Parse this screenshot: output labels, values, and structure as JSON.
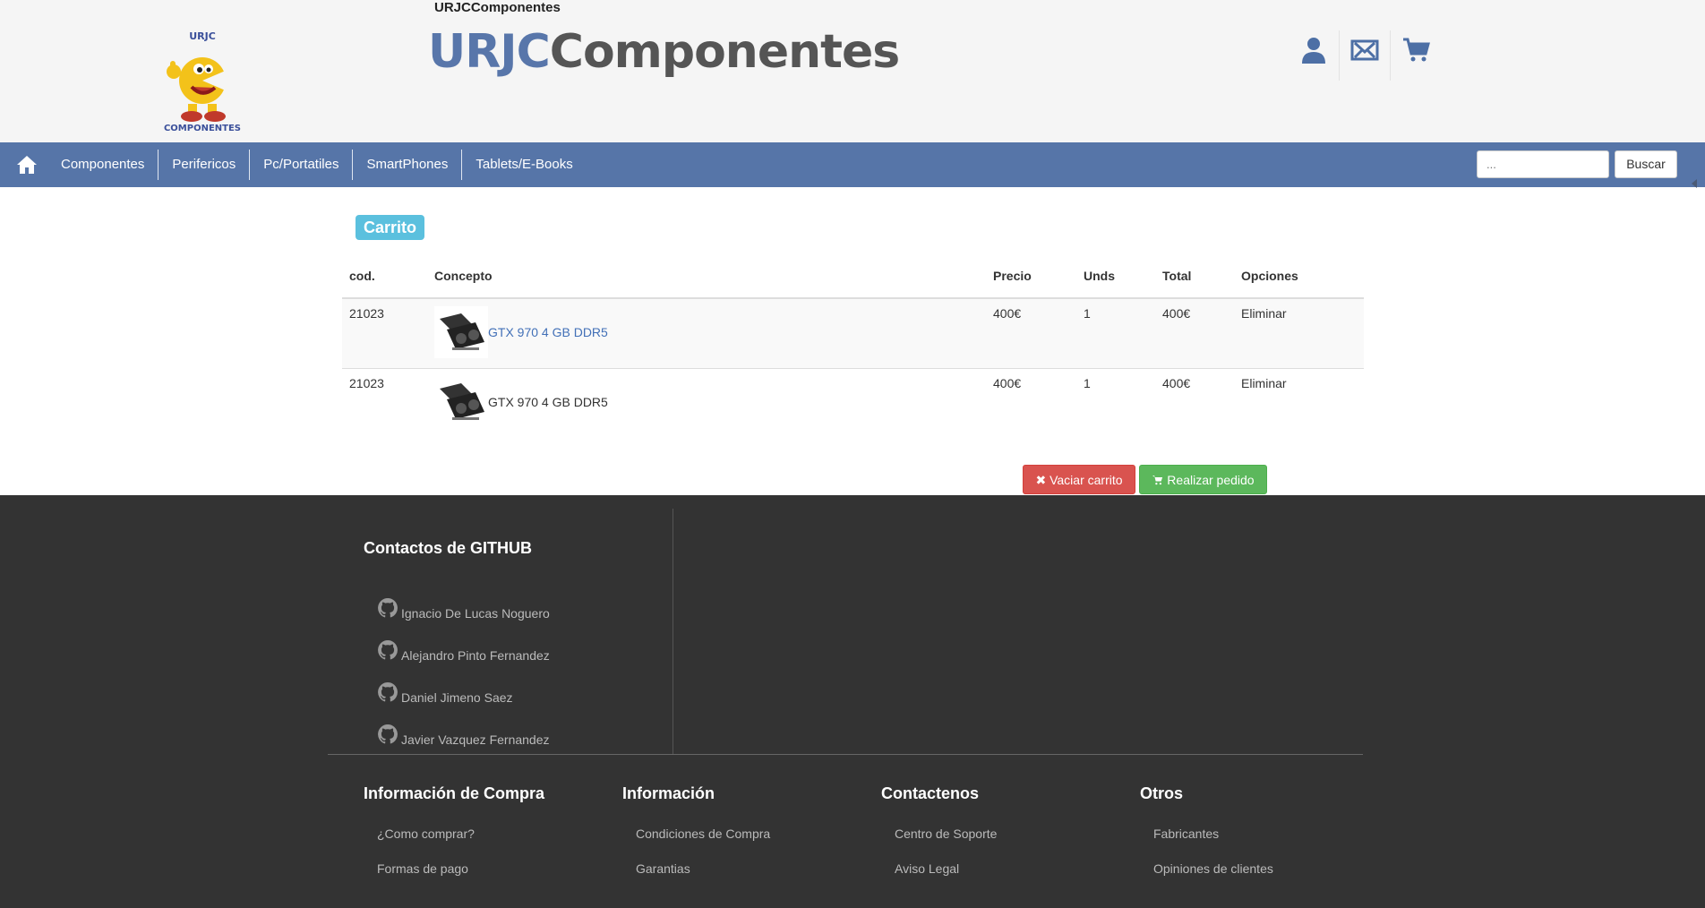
{
  "header": {
    "top_name": "URJCComponentes",
    "brand_part1": "URJC",
    "brand_part2": "Componentes",
    "logo_text": "URJC COMPONENTES",
    "icons": [
      "user-icon",
      "envelope-icon",
      "cart-icon"
    ]
  },
  "nav": {
    "home_icon": "home-icon",
    "items": [
      "Componentes",
      "Perifericos",
      "Pc/Portatiles",
      "SmartPhones",
      "Tablets/E-Books"
    ],
    "search_placeholder": "...",
    "search_button": "Buscar"
  },
  "cart": {
    "label": "Carrito",
    "columns": [
      "cod.",
      "Concepto",
      "Precio",
      "Unds",
      "Total",
      "Opciones"
    ],
    "rows": [
      {
        "cod": "21023",
        "concept": "GTX 970 4 GB DDR5",
        "price": "400€",
        "units": "1",
        "total": "400€",
        "option": "Eliminar"
      },
      {
        "cod": "21023",
        "concept": "GTX 970 4 GB DDR5",
        "price": "400€",
        "units": "1",
        "total": "400€",
        "option": "Eliminar"
      }
    ],
    "empty_button": "Vaciar carrito",
    "order_button": "Realizar pedido"
  },
  "footer": {
    "github_title": "Contactos de GITHUB",
    "github_contacts": [
      "Ignacio De Lucas Noguero",
      "Alejandro Pinto Fernandez",
      "Daniel Jimeno Saez",
      "Javier Vazquez Fernandez"
    ],
    "columns": [
      {
        "title": "Información de Compra",
        "links": [
          "¿Como comprar?",
          "Formas de pago"
        ]
      },
      {
        "title": "Información",
        "links": [
          "Condiciones de Compra",
          "Garantias"
        ]
      },
      {
        "title": "Contactenos",
        "links": [
          "Centro de Soporte",
          "Aviso Legal"
        ]
      },
      {
        "title": "Otros",
        "links": [
          "Fabricantes",
          "Opiniones de clientes"
        ]
      }
    ]
  },
  "colors": {
    "nav": "#5675a8",
    "brand_blue": "#5876aa",
    "footer": "#333333",
    "danger": "#d9534f",
    "success": "#5cb85c",
    "info": "#5bc0de"
  }
}
